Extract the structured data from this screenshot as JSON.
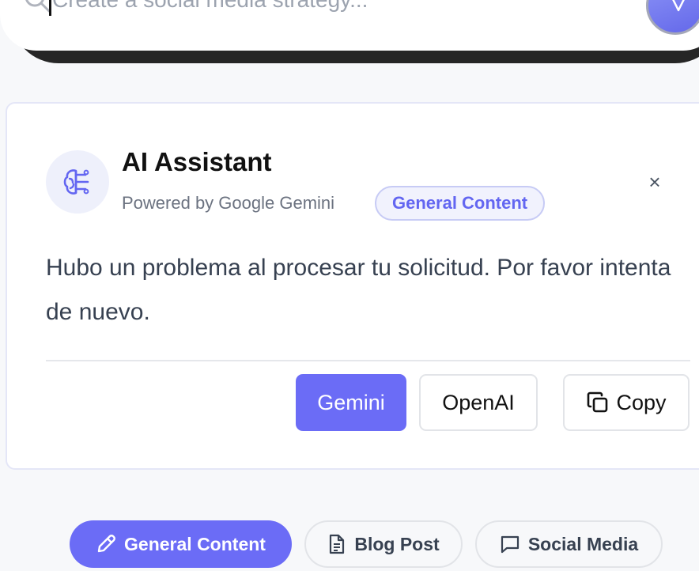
{
  "search": {
    "placeholder": "Create a social media strategy..."
  },
  "assistant": {
    "title": "AI Assistant",
    "subtitle": "Powered by Google Gemini",
    "badge": "General Content",
    "close_label": "×",
    "message": "Hubo un problema al procesar tu solicitud. Por favor intenta de nuevo.",
    "actions": {
      "gemini_label": "Gemini",
      "openai_label": "OpenAI",
      "copy_label": "Copy"
    },
    "icon": "brain-icon"
  },
  "tabs": [
    {
      "label": "General Content",
      "icon": "pencil-icon",
      "active": true
    },
    {
      "label": "Blog Post",
      "icon": "document-icon",
      "active": false
    },
    {
      "label": "Social Media",
      "icon": "chat-bubble-icon",
      "active": false
    }
  ],
  "colors": {
    "accent": "#6b6cf6",
    "badge_text": "#6366f1",
    "background": "#f7f8fa"
  }
}
